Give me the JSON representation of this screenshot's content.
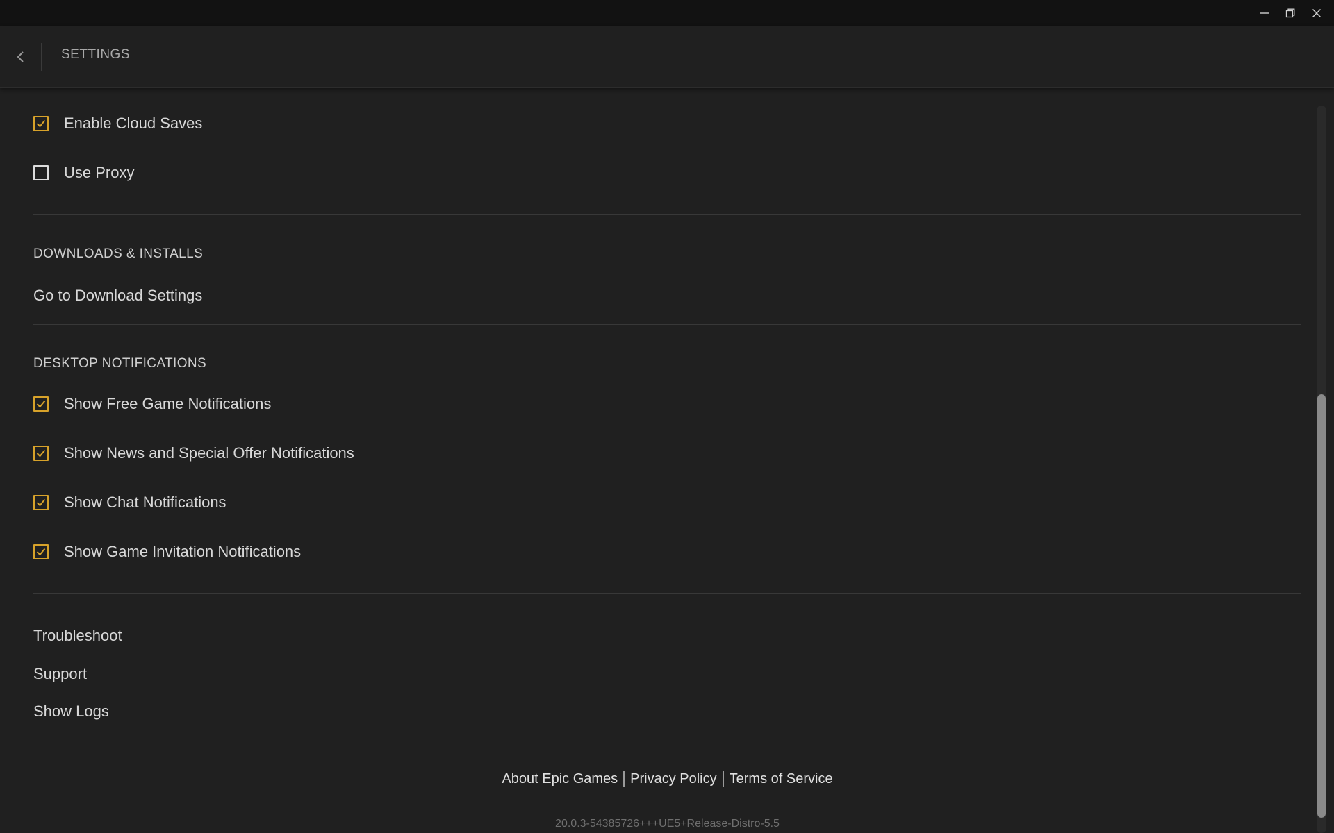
{
  "window": {
    "minimize_icon": "minimize-icon",
    "restore_icon": "restore-icon",
    "close_icon": "close-icon"
  },
  "header": {
    "back_icon": "chevron-left-icon",
    "title": "SETTINGS"
  },
  "general": {
    "items": [
      {
        "label": "Enable Cloud Saves",
        "checked": true
      },
      {
        "label": "Use Proxy",
        "checked": false
      }
    ]
  },
  "downloads": {
    "section_title": "DOWNLOADS & INSTALLS",
    "link": "Go to Download Settings"
  },
  "notifications": {
    "section_title": "DESKTOP NOTIFICATIONS",
    "items": [
      {
        "label": "Show Free Game Notifications",
        "checked": true
      },
      {
        "label": "Show News and Special Offer Notifications",
        "checked": true
      },
      {
        "label": "Show Chat Notifications",
        "checked": true
      },
      {
        "label": "Show Game Invitation Notifications",
        "checked": true
      }
    ]
  },
  "help": {
    "troubleshoot": "Troubleshoot",
    "support": "Support",
    "show_logs": "Show Logs"
  },
  "footer": {
    "about": "About Epic Games",
    "privacy": "Privacy Policy",
    "terms": "Terms of Service",
    "version": "20.0.3-54385726+++UE5+Release-Distro-5.5"
  },
  "colors": {
    "accent": "#d7a22a",
    "background": "#202020",
    "titlebar": "#121212"
  }
}
